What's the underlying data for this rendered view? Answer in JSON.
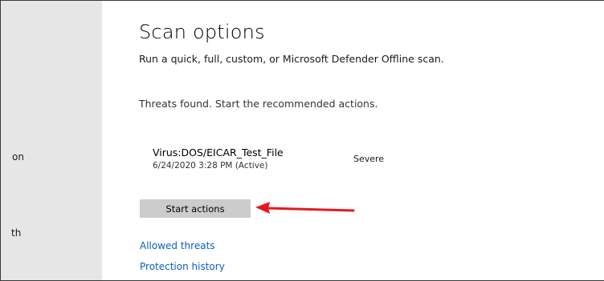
{
  "sidebar": {
    "fragments": [
      "on",
      "th"
    ]
  },
  "scan": {
    "title": "Scan options",
    "description": "Run a quick, full, custom, or Microsoft Defender Offline scan.",
    "status": "Threats found. Start the recommended actions."
  },
  "threat": {
    "name": "Virus:DOS/EICAR_Test_File",
    "date": "6/24/2020 3:28 PM (Active)",
    "severity": "Severe"
  },
  "actions": {
    "start_label": "Start actions"
  },
  "links": {
    "allowed": "Allowed threats",
    "history": "Protection history"
  },
  "colors": {
    "link": "#0a5ec4",
    "button_bg": "#cccccc",
    "sidebar_bg": "#e6e6e6",
    "arrow": "#e8191b"
  },
  "icons": {
    "annotation": "red-arrow-icon"
  }
}
